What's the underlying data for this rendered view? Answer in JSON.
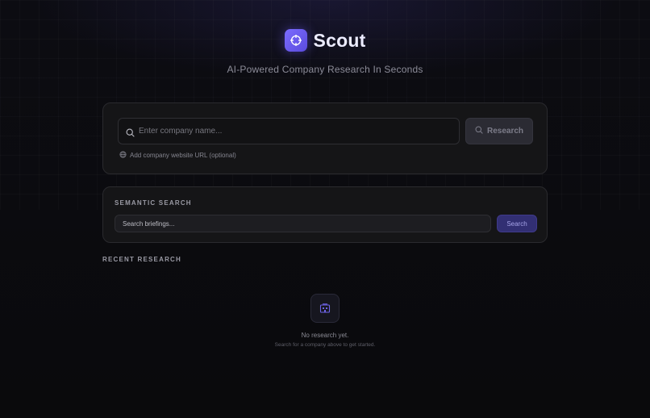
{
  "header": {
    "app_name": "Scout",
    "tagline": "AI-Powered Company Research In Seconds",
    "logo_icon": "crosshair-icon",
    "accent_color": "#6b5cf0"
  },
  "research": {
    "company_placeholder": "Enter company name...",
    "company_value": "",
    "research_label": "Research",
    "url_link_label": "Add company website URL (optional)"
  },
  "semantic": {
    "title": "SEMANTIC SEARCH",
    "placeholder": "Search briefings...",
    "value": "",
    "button_label": "Search"
  },
  "recent": {
    "title": "RECENT RESEARCH",
    "empty_title": "No research yet.",
    "empty_subtitle": "Search for a company above to get started.",
    "empty_icon": "building-icon"
  }
}
